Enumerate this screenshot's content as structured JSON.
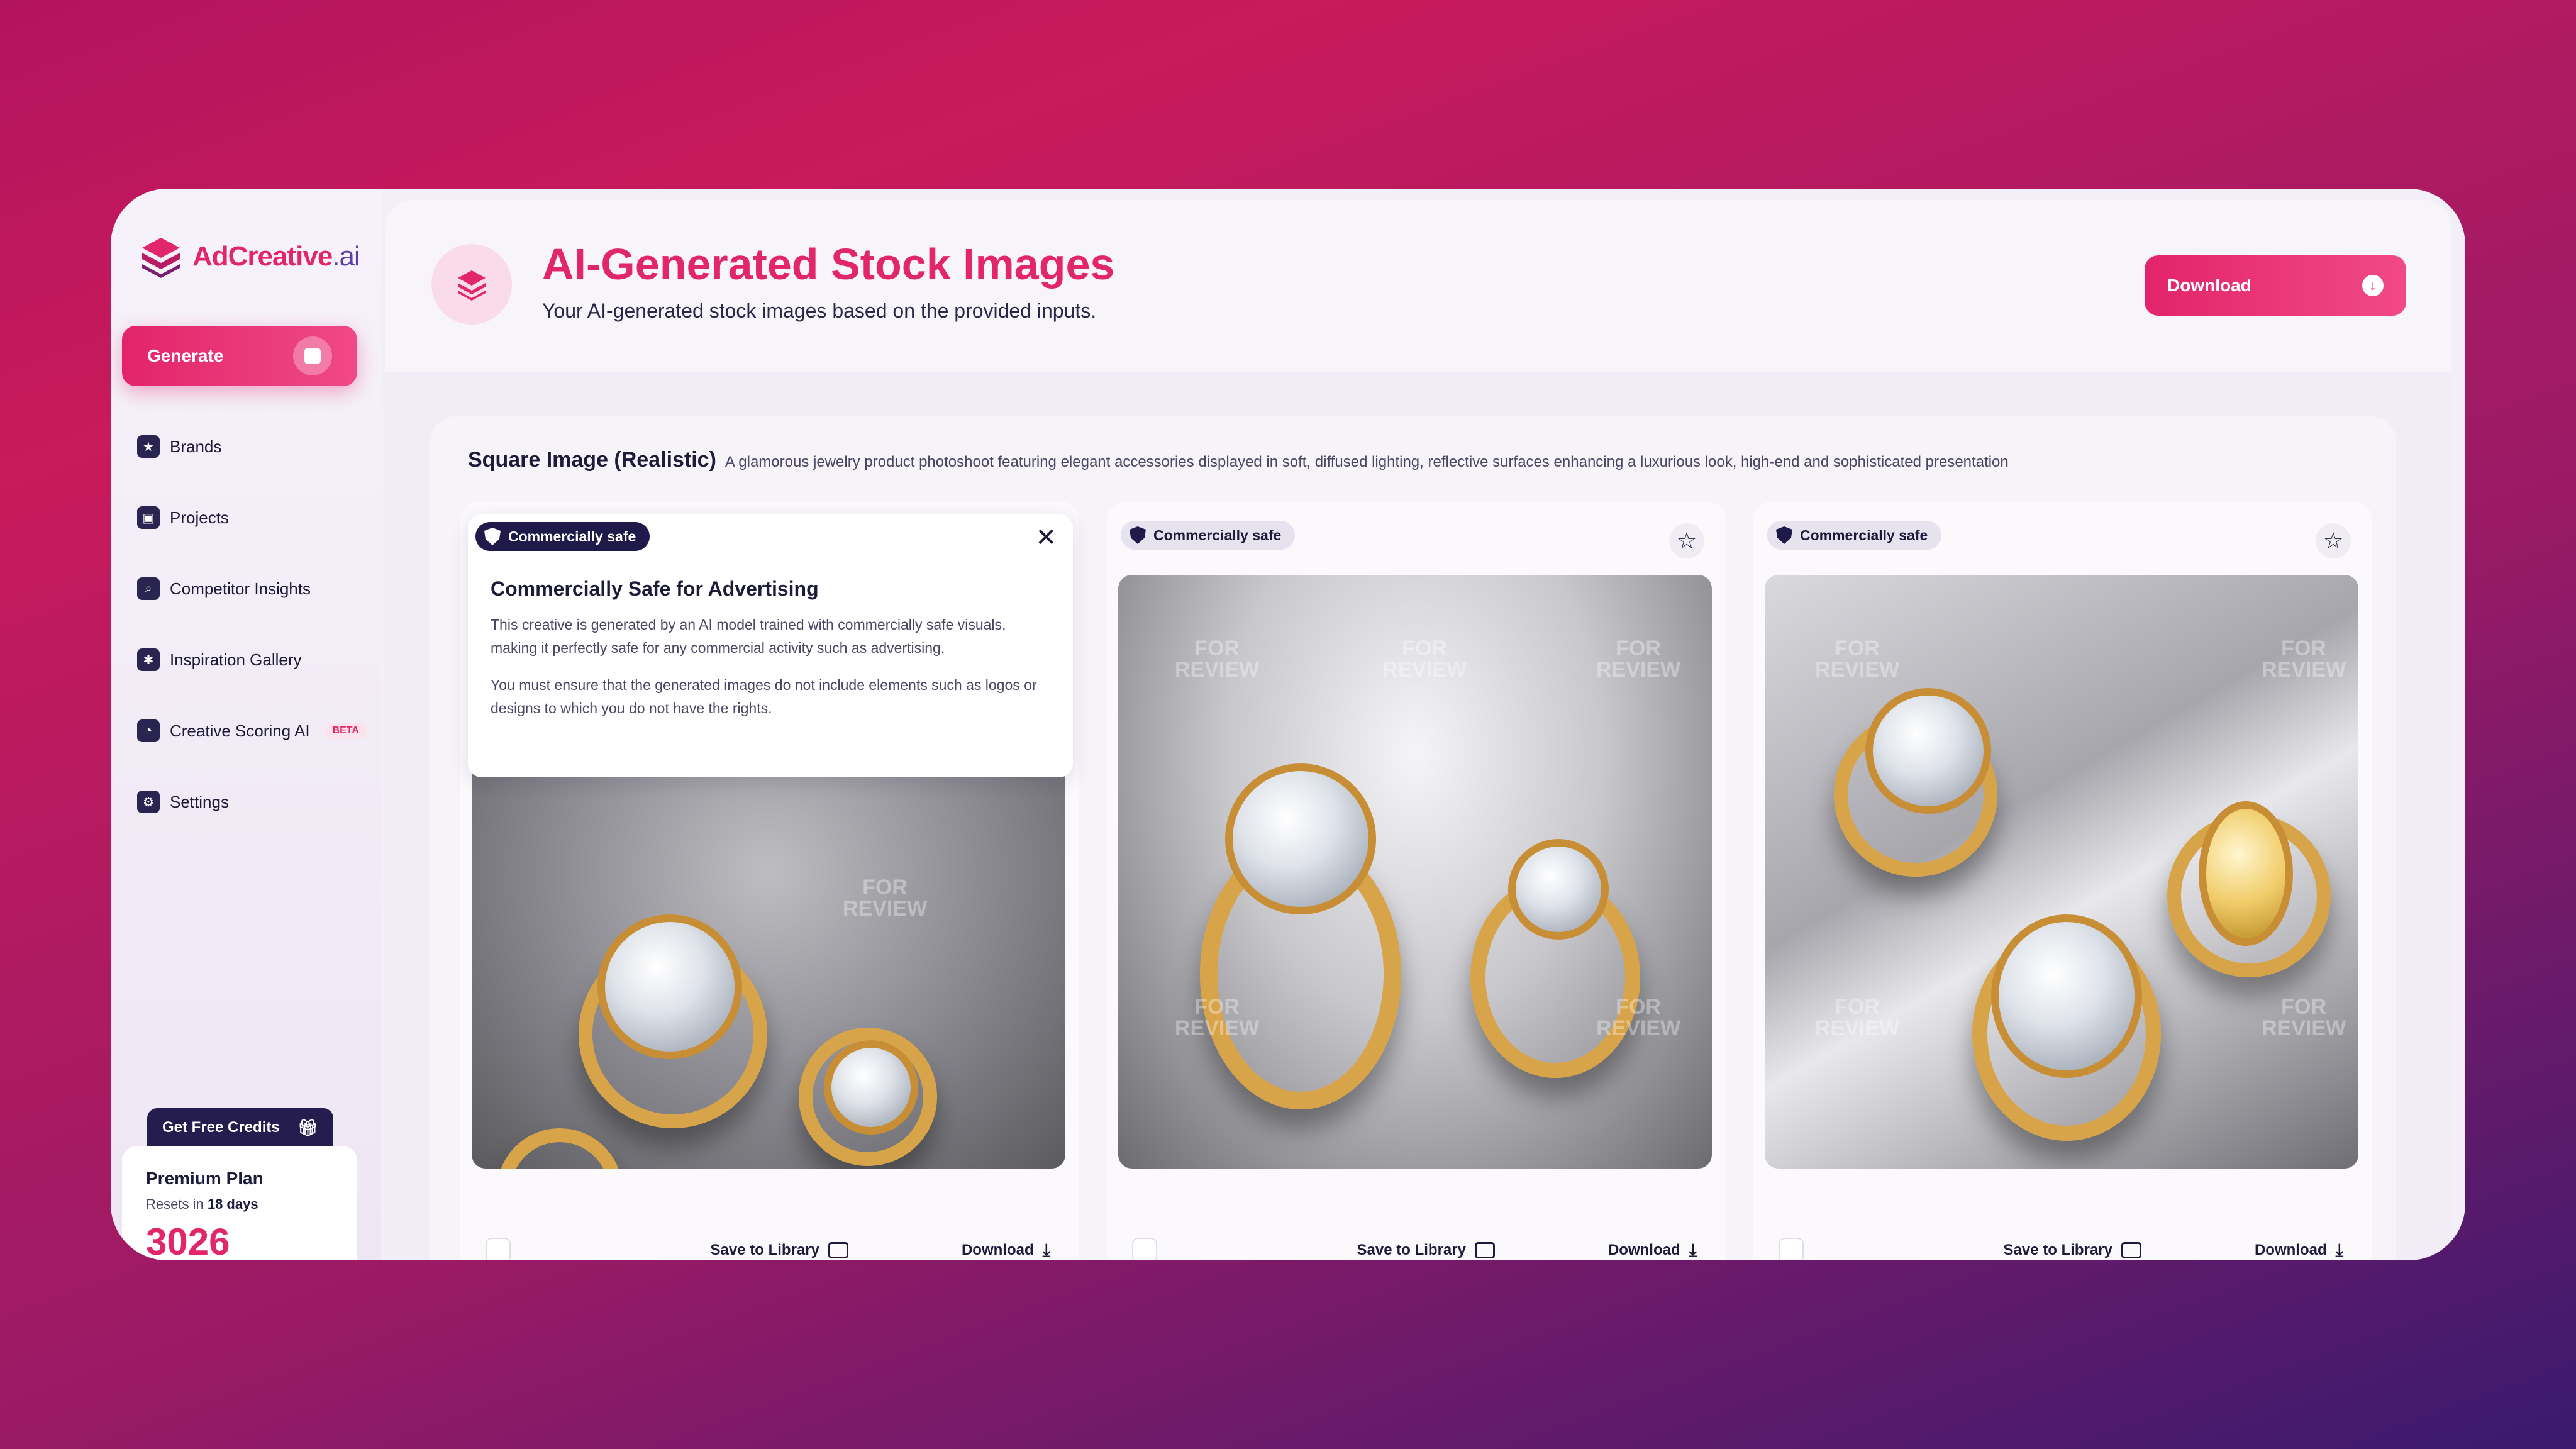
{
  "brand": {
    "name_main": "AdCreative",
    "name_suffix": ".ai"
  },
  "sidebar": {
    "generate_label": "Generate",
    "items": [
      {
        "label": "Brands",
        "icon": "star-icon"
      },
      {
        "label": "Projects",
        "icon": "projects-icon"
      },
      {
        "label": "Competitor Insights",
        "icon": "search-icon"
      },
      {
        "label": "Inspiration Gallery",
        "icon": "bulb-icon"
      },
      {
        "label": "Creative Scoring AI",
        "icon": "gauge-icon",
        "badge": "BETA"
      },
      {
        "label": "Settings",
        "icon": "gear-icon"
      }
    ],
    "credits_tab": "Get Free Credits",
    "plan": {
      "title": "Premium Plan",
      "reset_prefix": "Resets in",
      "reset_days": "18 days",
      "credits": "3026"
    }
  },
  "header": {
    "title": "AI-Generated Stock Images",
    "subtitle": "Your AI-generated stock images based on the provided inputs.",
    "download_label": "Download"
  },
  "panel": {
    "title": "Square Image (Realistic)",
    "description": "A glamorous jewelry product photoshoot featuring elegant accessories displayed in soft, diffused lighting, reflective surfaces enhancing a luxurious look, high-end and sophisticated presentation"
  },
  "cards": [
    {
      "badge": "Commercially safe",
      "save_label": "Save to Library",
      "download_label": "Download"
    },
    {
      "badge": "Commercially safe",
      "save_label": "Save to Library",
      "download_label": "Download"
    },
    {
      "badge": "Commercially safe",
      "save_label": "Save to Library",
      "download_label": "Download"
    }
  ],
  "watermark": {
    "line1": "FOR",
    "line2": "REVIEW"
  },
  "popup": {
    "title": "Commercially Safe for Advertising",
    "p1": "This creative is generated by an AI model trained with commercially safe visuals, making it perfectly safe for any commercial activity such as advertising.",
    "p2": "You must ensure that the generated images do not include elements such as logos or designs to which you do not have the rights."
  },
  "colors": {
    "accent": "#e2266a",
    "navy": "#1f1a4a",
    "bg": "#f3eff8"
  }
}
